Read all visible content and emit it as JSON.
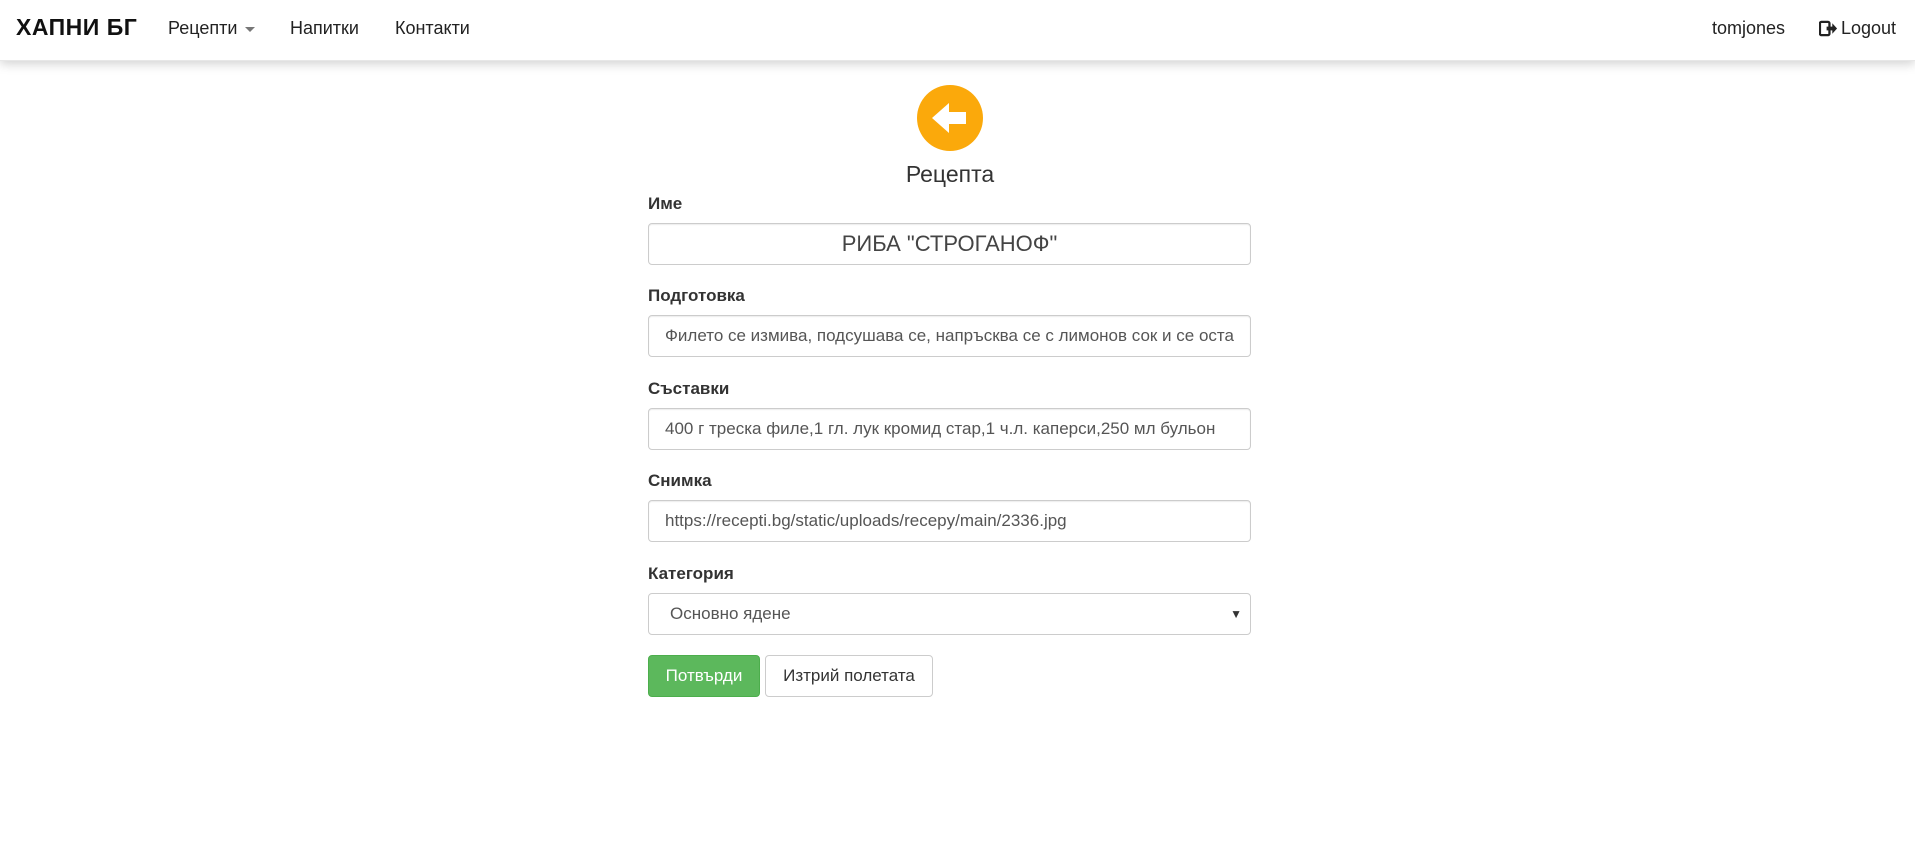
{
  "navbar": {
    "brand": "ХАПНИ БГ",
    "items": [
      {
        "label": "Рецепти",
        "has_dropdown": true
      },
      {
        "label": "Напитки"
      },
      {
        "label": "Контакти"
      }
    ],
    "username": "tomjones",
    "logout_label": "Logout",
    "logout_icon": "logout-icon"
  },
  "page": {
    "back_icon": "arrow-left-circle-icon",
    "title": "Рецепта"
  },
  "form": {
    "name": {
      "label": "Име",
      "value": "РИБА \"СТРОГАНОФ\""
    },
    "preparation": {
      "label": "Подготовка",
      "value": "Филето се измива, подсушава се, напръсква се с лимонов сок и се оставя"
    },
    "ingredients": {
      "label": "Съставки",
      "value": "400 г треска филе,1 гл. лук кромид стар,1 ч.л. каперси,250 мл бульон"
    },
    "photo": {
      "label": "Снимка",
      "value": "https://recepti.bg/static/uploads/recepy/main/2336.jpg"
    },
    "category": {
      "label": "Категория",
      "selected": "Основно ядене"
    },
    "submit_label": "Потвърди",
    "reset_label": "Изтрий полетата"
  },
  "colors": {
    "accent": "#fba90b",
    "success": "#5cb85c"
  }
}
